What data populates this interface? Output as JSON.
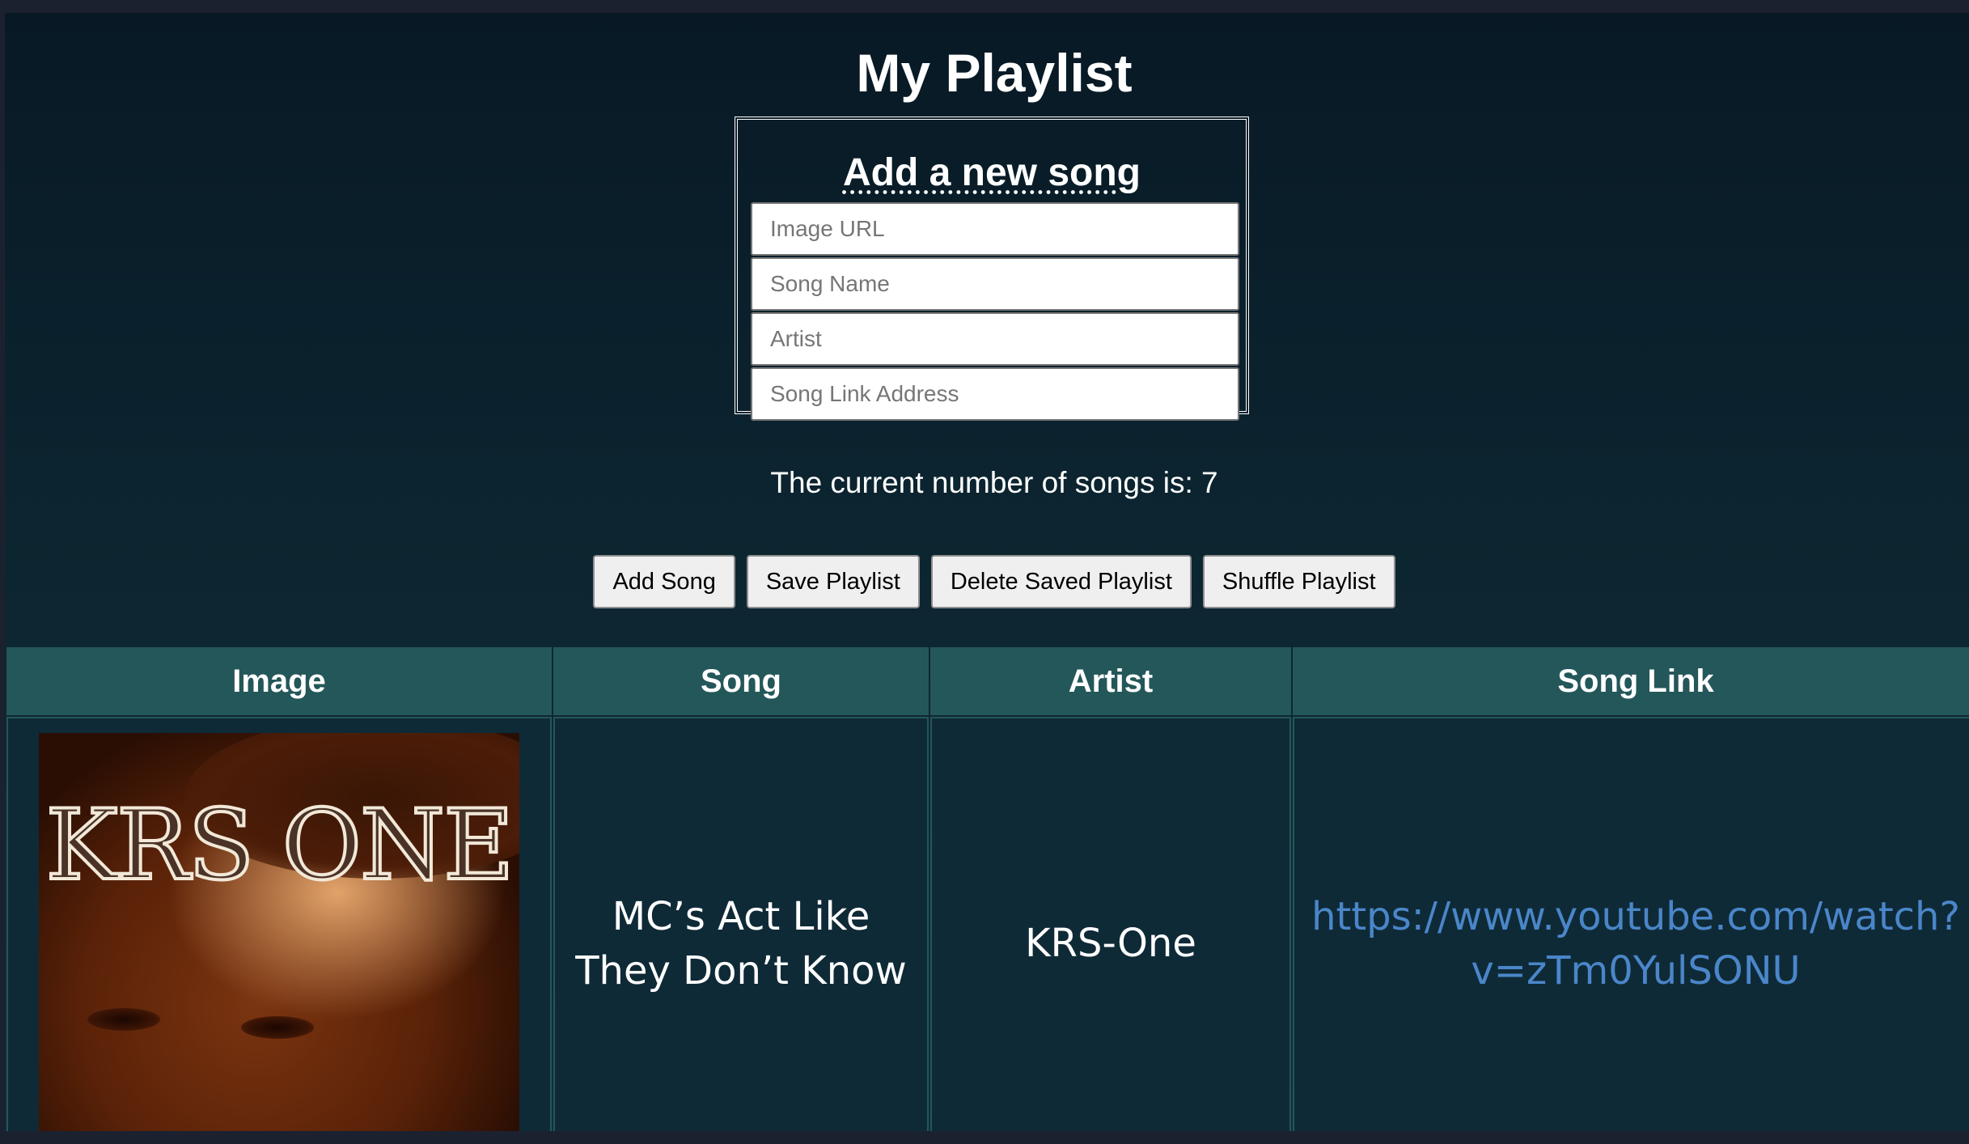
{
  "page": {
    "title": "My Playlist"
  },
  "form": {
    "heading": "Add a new song",
    "image_url_placeholder": "Image URL",
    "song_name_placeholder": "Song Name",
    "artist_placeholder": "Artist",
    "song_link_placeholder": "Song Link Address"
  },
  "count": {
    "text": "The current number of songs is: 7"
  },
  "buttons": {
    "add": "Add Song",
    "save": "Save Playlist",
    "delete": "Delete Saved Playlist",
    "shuffle": "Shuffle Playlist"
  },
  "table": {
    "headers": [
      "Image",
      "Song",
      "Artist",
      "Song Link"
    ],
    "rows": [
      {
        "image_text": "KRS ONE",
        "song": "MC’s Act Like They Don’t Know",
        "artist": "KRS-One",
        "link_line1": "https://www.youtube.com/watch?",
        "link_line2": "v=zTm0YulSONU"
      }
    ]
  },
  "colors": {
    "header_bg": "#24575a",
    "link": "#4a86c9",
    "page_bg": "#0c2530"
  }
}
